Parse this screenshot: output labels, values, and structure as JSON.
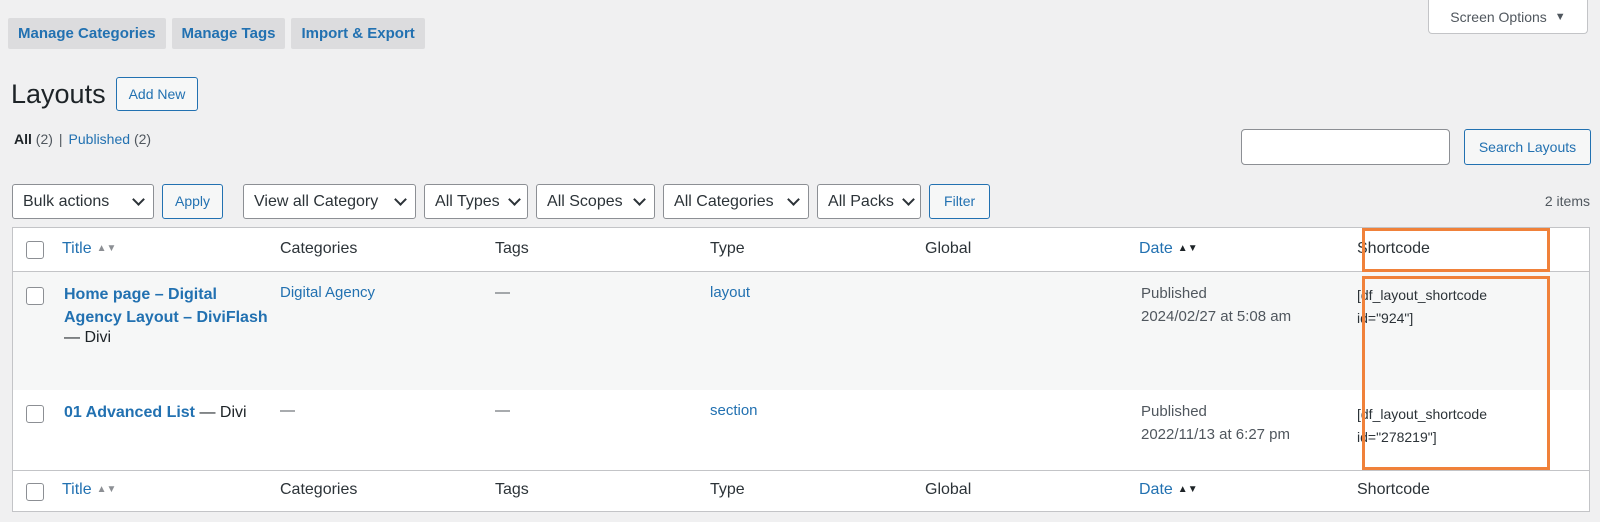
{
  "top_tabs": [
    "Manage Categories",
    "Manage Tags",
    "Import & Export"
  ],
  "screen_options": "Screen Options",
  "page_title": "Layouts",
  "add_new": "Add New",
  "views": {
    "all_label": "All",
    "all_count": "(2)",
    "separator": "|",
    "published_label": "Published",
    "published_count": "(2)"
  },
  "search": {
    "button": "Search Layouts",
    "value": ""
  },
  "filters": {
    "bulk_actions": "Bulk actions",
    "apply": "Apply",
    "category": "View all Category",
    "types": "All Types",
    "scopes": "All Scopes",
    "categories": "All Categories",
    "packs": "All Packs",
    "filter": "Filter"
  },
  "items_count": "2 items",
  "table": {
    "columns": {
      "title": "Title",
      "categories": "Categories",
      "tags": "Tags",
      "type": "Type",
      "global": "Global",
      "date": "Date",
      "shortcode": "Shortcode"
    },
    "rows": [
      {
        "title_line1": "Home page – Digital",
        "title_line2": "Agency Layout – DiviFlash",
        "title_state": "— Divi",
        "category": "Digital Agency",
        "tags": "—",
        "type": "layout",
        "global": "",
        "date_status": "Published",
        "date_value": "2024/02/27 at 5:08 am",
        "shortcode_line1": "[df_layout_shortcode",
        "shortcode_line2": "id=\"924\"]"
      },
      {
        "title_line1": "01 Advanced List",
        "title_state": "— Divi",
        "category": "—",
        "tags": "—",
        "type": "section",
        "global": "",
        "date_status": "Published",
        "date_value": "2022/11/13 at 6:27 pm",
        "shortcode_line1": "[df_layout_shortcode",
        "shortcode_line2": "id=\"278219\"]"
      }
    ]
  },
  "colors": {
    "link": "#2271b1",
    "highlight": "#f0813a",
    "background": "#f0f0f1"
  }
}
